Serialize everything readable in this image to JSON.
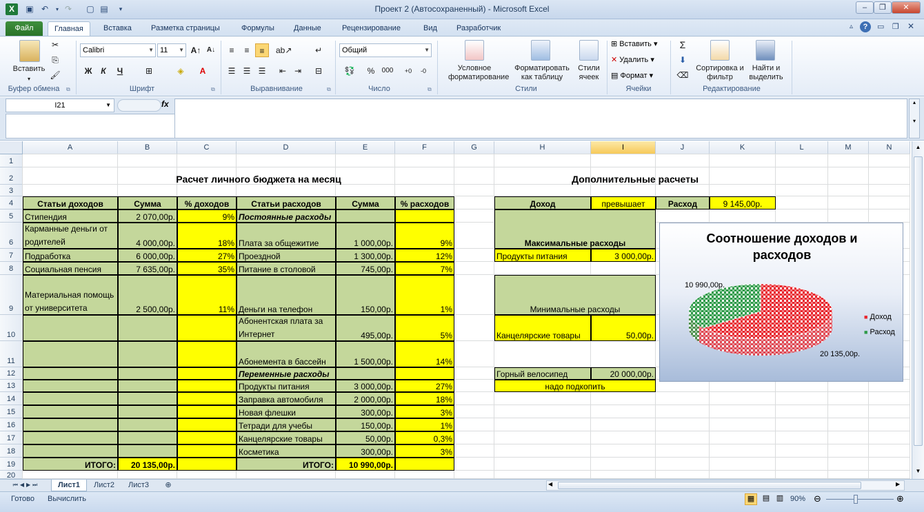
{
  "window": {
    "title": "Проект 2 (Автосохраненный)  -  Microsoft Excel"
  },
  "tabs": [
    "Файл",
    "Главная",
    "Вставка",
    "Разметка страницы",
    "Формулы",
    "Данные",
    "Рецензирование",
    "Вид",
    "Разработчик"
  ],
  "ribbon": {
    "clipboard": {
      "paste": "Вставить",
      "label": "Буфер обмена"
    },
    "font": {
      "name": "Calibri",
      "size": "11",
      "label": "Шрифт",
      "bold": "Ж",
      "italic": "К",
      "underline": "Ч"
    },
    "alignment": {
      "label": "Выравнивание"
    },
    "number": {
      "format": "Общий",
      "label": "Число",
      "percent": "%",
      "thousands": "000"
    },
    "styles": {
      "conditional": "Условное форматирование",
      "astable": "Форматировать как таблицу",
      "cellstyles": "Стили ячеек",
      "label": "Стили"
    },
    "cells": {
      "insert": "Вставить",
      "delete": "Удалить",
      "format": "Формат",
      "label": "Ячейки"
    },
    "editing": {
      "sort": "Сортировка и фильтр",
      "find": "Найти и выделить",
      "label": "Редактирование"
    }
  },
  "formula": {
    "namebox": "I21",
    "fx": "fx",
    "value": ""
  },
  "columns": [
    "A",
    "B",
    "C",
    "D",
    "E",
    "F",
    "G",
    "H",
    "I",
    "J",
    "K",
    "L",
    "M",
    "N"
  ],
  "rows": [
    "1",
    "2",
    "3",
    "4",
    "5",
    "6",
    "7",
    "8",
    "9",
    "10",
    "11",
    "12",
    "13",
    "14",
    "15",
    "16",
    "17",
    "18",
    "19",
    "20"
  ],
  "sheet": {
    "title_left": "Расчет личного бюджета на месяц",
    "title_right": "Дополнительные расчеты",
    "headers": [
      "Статьи доходов",
      "Сумма",
      "% доходов",
      "Статьи расходов",
      "Сумма",
      "% расходов"
    ],
    "income": [
      {
        "name": "Стипендия",
        "sum": "2 070,00р.",
        "pct": "9%"
      },
      {
        "name": "Карманные деньги от родителей",
        "sum": "4 000,00р.",
        "pct": "18%"
      },
      {
        "name": "Подработка",
        "sum": "6 000,00р.",
        "pct": "27%"
      },
      {
        "name": "Социальная пенсия",
        "sum": "7 635,00р.",
        "pct": "35%"
      },
      {
        "name": "Материальная помощь от университета",
        "sum": "2 500,00р.",
        "pct": "11%"
      }
    ],
    "fixed_label": "Постоянные расходы",
    "variable_label": "Переменные расходы",
    "expenses": [
      {
        "name": "Плата за общежитие",
        "sum": "1 000,00р.",
        "pct": "9%"
      },
      {
        "name": "Проездной",
        "sum": "1 300,00р.",
        "pct": "12%"
      },
      {
        "name": "Питание в столовой",
        "sum": "745,00р.",
        "pct": "7%"
      },
      {
        "name": "Деньги на телефон",
        "sum": "150,00р.",
        "pct": "1%"
      },
      {
        "name": "Абонентская плата за Интернет",
        "sum": "495,00р.",
        "pct": "5%"
      },
      {
        "name": "Абонемента в бассейн",
        "sum": "1 500,00р.",
        "pct": "14%"
      },
      {
        "name": "Продукты питания",
        "sum": "3 000,00р.",
        "pct": "27%"
      },
      {
        "name": "Заправка автомобиля",
        "sum": "2 000,00р.",
        "pct": "18%"
      },
      {
        "name": "Новая флешки",
        "sum": "300,00р.",
        "pct": "3%"
      },
      {
        "name": "Тетради для учебы",
        "sum": "150,00р.",
        "pct": "1%"
      },
      {
        "name": "Канцелярские товары",
        "sum": "50,00р.",
        "pct": "0,3%"
      },
      {
        "name": "Косметика",
        "sum": "300,00р.",
        "pct": "3%"
      }
    ],
    "total_label": "ИТОГО:",
    "total_income": "20 135,00р.",
    "total_expense": "10 990,00р.",
    "extra": {
      "income_label": "Доход",
      "compare": "превышает",
      "expense_label": "Расход",
      "expense_value": "9 145,00р.",
      "max_label": "Максимальные расходы",
      "max_item": "Продукты питания",
      "max_value": "3 000,00р.",
      "min_label": "Минимальные расходы",
      "min_item": "Канцелярские товары",
      "min_value": "50,00р.",
      "goal_item": "Горный велосипед",
      "goal_value": "20 000,00р.",
      "goal_status": "надо подкопить"
    }
  },
  "chart_data": {
    "type": "pie",
    "title": "Соотношение доходов и расходов",
    "categories": [
      "Доход",
      "Расход"
    ],
    "values": [
      20135,
      10990
    ],
    "data_labels": [
      "20 135,00р.",
      "10 990,00р."
    ],
    "colors": [
      "#e8242c",
      "#2e9a49"
    ],
    "legend": "right"
  },
  "sheets": [
    "Лист1",
    "Лист2",
    "Лист3"
  ],
  "status": {
    "ready": "Готово",
    "calc": "Вычислить",
    "zoom": "90%"
  }
}
